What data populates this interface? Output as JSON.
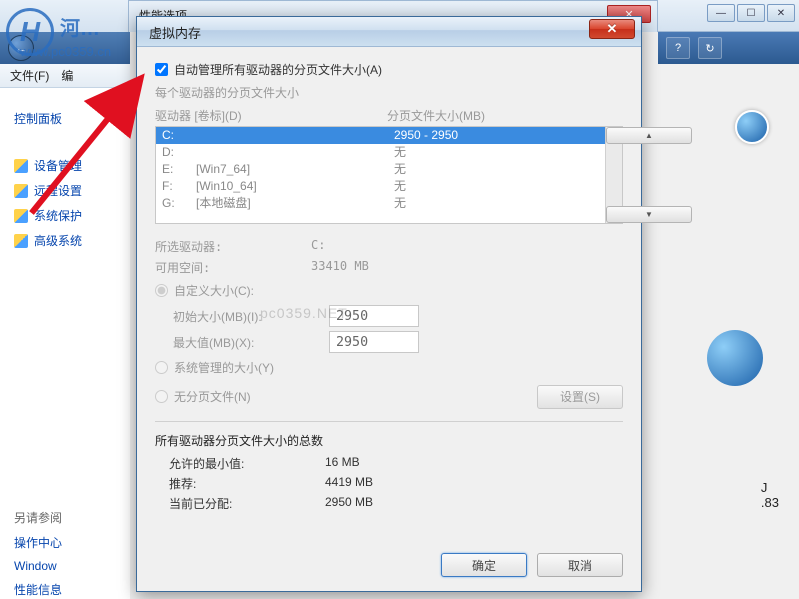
{
  "logo": {
    "letter": "H",
    "text": "河…",
    "url": "www.pc0359.cn"
  },
  "watermark": "pc0359.NET",
  "bg_titlebar_btns": [
    "—",
    "☐",
    "✕"
  ],
  "bg_toolbar_btns": [
    "?",
    "↻"
  ],
  "control_panel": {
    "nav_back": "←",
    "file_menu": "文件(F)",
    "edit_menu": "编",
    "home_link": "控制面板",
    "shield_links": [
      "设备管理",
      "远程设置",
      "系统保护",
      "高级系统"
    ],
    "see_also": "另请参阅",
    "links2": [
      "操作中心",
      "Window",
      "性能信息"
    ]
  },
  "right_text": {
    "line1": "J",
    "line2": ".83"
  },
  "perf_options": {
    "title": "性能选项",
    "close": "✕"
  },
  "dialog": {
    "title": "虚拟内存",
    "close": "✕",
    "auto_manage": "自动管理所有驱动器的分页文件大小(A)",
    "per_drive_label": "每个驱动器的分页文件大小",
    "col_drive": "驱动器 [卷标](D)",
    "col_paging": "分页文件大小(MB)",
    "drives": [
      {
        "letter": "C:",
        "label": "",
        "size": "2950 - 2950",
        "selected": true
      },
      {
        "letter": "D:",
        "label": "",
        "size": "无"
      },
      {
        "letter": "E:",
        "label": "[Win7_64]",
        "size": "无"
      },
      {
        "letter": "F:",
        "label": "[Win10_64]",
        "size": "无"
      },
      {
        "letter": "G:",
        "label": "[本地磁盘]",
        "size": "无"
      }
    ],
    "scroll_up": "▲",
    "scroll_down": "▼",
    "selected_drive_label": "所选驱动器:",
    "selected_drive_value": "C:",
    "free_space_label": "可用空间:",
    "free_space_value": "33410 MB",
    "custom_size": "自定义大小(C):",
    "initial_size_label": "初始大小(MB)(I):",
    "initial_size_value": "2950",
    "max_size_label": "最大值(MB)(X):",
    "max_size_value": "2950",
    "system_managed": "系统管理的大小(Y)",
    "no_paging": "无分页文件(N)",
    "set_button": "设置(S)",
    "totals_label": "所有驱动器分页文件大小的总数",
    "min_allowed_label": "允许的最小值:",
    "min_allowed_value": "16 MB",
    "recommended_label": "推荐:",
    "recommended_value": "4419 MB",
    "current_label": "当前已分配:",
    "current_value": "2950 MB",
    "ok": "确定",
    "cancel": "取消"
  }
}
